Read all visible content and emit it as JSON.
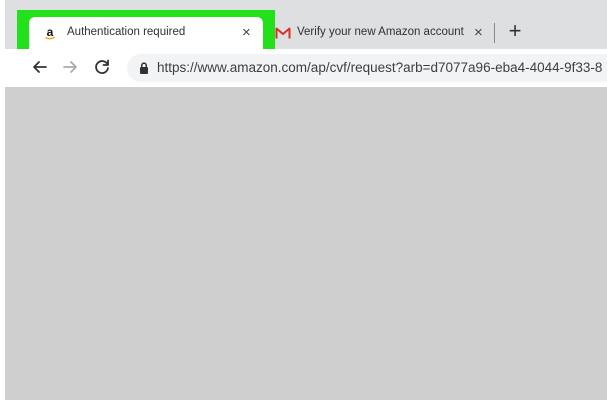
{
  "tabs": [
    {
      "title": "Authentication required",
      "favicon": "amazon-icon",
      "active": true
    },
    {
      "title": "Verify your new Amazon account",
      "favicon": "gmail-icon",
      "active": false
    }
  ],
  "new_tab_label": "+",
  "close_label": "×",
  "address_bar": {
    "url": "https://www.amazon.com/ap/cvf/request?arb=d7077a96-eba4-4044-9f33-8"
  },
  "colors": {
    "highlight": "#22e01a",
    "gmail_red": "#d93025"
  }
}
